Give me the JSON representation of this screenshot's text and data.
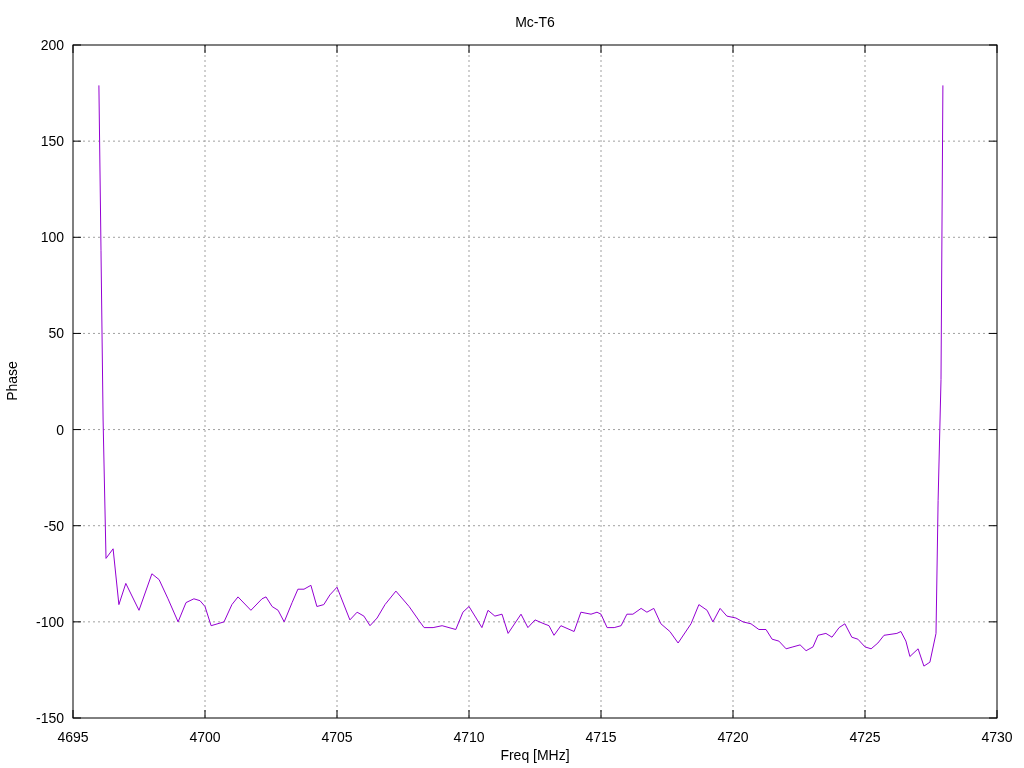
{
  "chart_data": {
    "type": "line",
    "title": "Mc-T6",
    "xlabel": "Freq [MHz]",
    "ylabel": "Phase",
    "x": [
      4695.98,
      4696.06,
      4696.14,
      4696.25,
      4696.52,
      4696.74,
      4697.0,
      4697.5,
      4697.99,
      4698.26,
      4698.6,
      4698.98,
      4699.28,
      4699.58,
      4699.81,
      4700.0,
      4700.23,
      4700.72,
      4701.02,
      4701.25,
      4701.74,
      4702.16,
      4702.31,
      4702.54,
      4702.77,
      4703.0,
      4703.3,
      4703.52,
      4703.75,
      4704.01,
      4704.24,
      4704.5,
      4704.73,
      4705.0,
      4705.49,
      4705.76,
      4706.02,
      4706.25,
      4706.52,
      4706.82,
      4707.23,
      4707.73,
      4708.14,
      4708.3,
      4708.64,
      4708.98,
      4709.5,
      4709.77,
      4710.0,
      4710.27,
      4710.49,
      4710.72,
      4710.98,
      4711.25,
      4711.48,
      4711.97,
      4712.23,
      4712.5,
      4712.84,
      4713.03,
      4713.22,
      4713.48,
      4713.98,
      4714.24,
      4714.62,
      4714.85,
      4715.0,
      4715.23,
      4715.5,
      4715.76,
      4715.98,
      4716.21,
      4716.52,
      4716.74,
      4717.0,
      4717.27,
      4717.61,
      4717.92,
      4718.41,
      4718.71,
      4719.02,
      4719.24,
      4719.51,
      4719.77,
      4720.11,
      4720.38,
      4720.68,
      4720.98,
      4721.25,
      4721.48,
      4721.74,
      4722.01,
      4722.27,
      4722.54,
      4722.77,
      4723.03,
      4723.22,
      4723.52,
      4723.75,
      4724.02,
      4724.24,
      4724.5,
      4724.73,
      4725.0,
      4725.23,
      4725.49,
      4725.72,
      4726.21,
      4726.36,
      4726.55,
      4726.7,
      4727.01,
      4727.23,
      4727.46,
      4727.69,
      4727.77,
      4727.88,
      4727.95
    ],
    "series": [
      {
        "color": "#9400d3",
        "values": [
          179,
          93,
          5,
          -67,
          -62,
          -91,
          -80,
          -94,
          -75,
          -78,
          -88,
          -100,
          -90,
          -88,
          -89,
          -92,
          -102,
          -100,
          -91,
          -87,
          -94,
          -88,
          -87,
          -92,
          -94,
          -100,
          -90,
          -83,
          -83,
          -81,
          -92,
          -91,
          -86,
          -82,
          -99,
          -95,
          -97,
          -102,
          -98,
          -91,
          -84,
          -92,
          -100,
          -103,
          -103,
          -102,
          -104,
          -95,
          -92,
          -98,
          -103,
          -94,
          -97,
          -96,
          -106,
          -96,
          -103,
          -99,
          -101,
          -102,
          -107,
          -102,
          -105,
          -95,
          -96,
          -95,
          -96,
          -103,
          -103,
          -102,
          -96,
          -96,
          -93,
          -95,
          -93,
          -101,
          -105,
          -111,
          -101,
          -91,
          -94,
          -100,
          -93,
          -97,
          -98,
          -100,
          -101,
          -104,
          -104,
          -109,
          -110,
          -114,
          -113,
          -112,
          -115,
          -113,
          -107,
          -106,
          -108,
          -103,
          -101,
          -108,
          -109,
          -113,
          -114,
          -111,
          -107,
          -106,
          -105,
          -110,
          -118,
          -114,
          -123,
          -121,
          -106,
          -37,
          26,
          179
        ]
      }
    ],
    "grid": true,
    "xlim": [
      4695,
      4730
    ],
    "ylim": [
      -150,
      200
    ],
    "xticks": [
      4695,
      4700,
      4705,
      4710,
      4715,
      4720,
      4725,
      4730
    ],
    "yticks": [
      -150,
      -100,
      -50,
      0,
      50,
      100,
      150,
      200
    ]
  }
}
